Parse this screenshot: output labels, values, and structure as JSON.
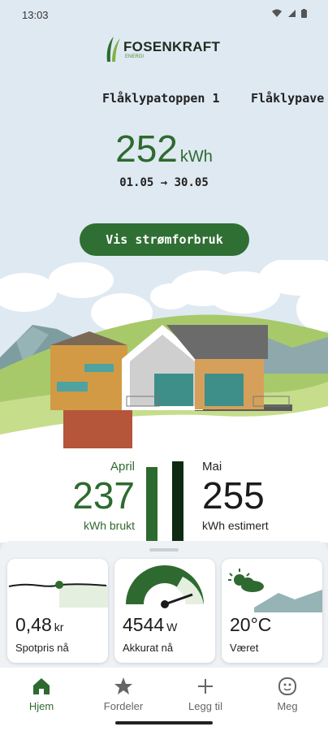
{
  "status_bar": {
    "time": "13:03"
  },
  "brand": {
    "name": "FOSENKRAFT",
    "sub": "ENERGI"
  },
  "sites": [
    "Flåklypatoppen 1",
    "Flåklypave"
  ],
  "usage": {
    "value": "252",
    "unit": "kWh",
    "period": "01.05 → 30.05"
  },
  "cta": {
    "label": "Vis strømforbruk"
  },
  "stats": {
    "previous": {
      "month": "April",
      "value": "237",
      "unit": "kWh brukt"
    },
    "current": {
      "month": "Mai",
      "value": "255",
      "unit": "kWh estimert"
    }
  },
  "cards": [
    {
      "value": "0,48",
      "unit": "kr",
      "label": "Spotpris nå",
      "icon": "spot-price-line-icon"
    },
    {
      "value": "4544",
      "unit": "W",
      "label": "Akkurat nå",
      "icon": "power-gauge-icon"
    },
    {
      "value": "20°C",
      "unit": "",
      "label": "Været",
      "icon": "partly-cloudy-icon"
    }
  ],
  "nav": [
    {
      "label": "Hjem",
      "icon": "home-icon",
      "active": true
    },
    {
      "label": "Fordeler",
      "icon": "star-icon",
      "active": false
    },
    {
      "label": "Legg til",
      "icon": "plus-icon",
      "active": false
    },
    {
      "label": "Meg",
      "icon": "face-icon",
      "active": false
    }
  ],
  "colors": {
    "accent": "#2e6a2f",
    "accent_dark": "#0f2a12",
    "background": "#dfe9f2"
  }
}
